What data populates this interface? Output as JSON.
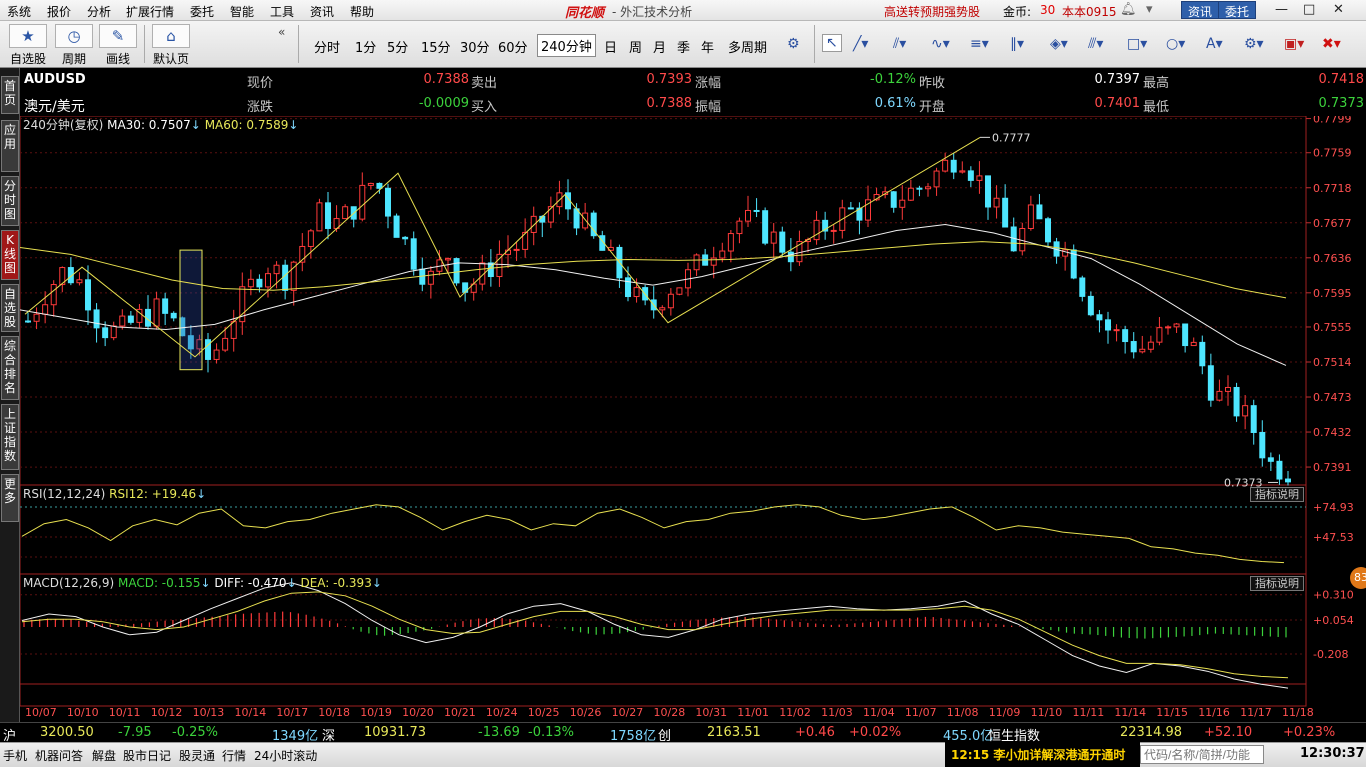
{
  "menu": [
    "系统",
    "报价",
    "分析",
    "扩展行情",
    "委托",
    "智能",
    "工具",
    "资讯",
    "帮助"
  ],
  "brand": {
    "logo": "同花顺",
    "subtitle": "- 外汇技术分析"
  },
  "topright": {
    "promo": "高送转预期强势股",
    "coin_label": "金币:",
    "coin_value": "30",
    "account": "本本0915",
    "btn_info": "资讯",
    "btn_trade": "委托"
  },
  "toolbar": {
    "groups": [
      {
        "label": "自选股",
        "icon": "star-icon"
      },
      {
        "label": "周期",
        "icon": "clock-icon"
      },
      {
        "label": "画线",
        "icon": "pencil-icon"
      },
      {
        "label": "默认页",
        "icon": "home-icon"
      }
    ],
    "collapse": "«",
    "periods": [
      "分时",
      "1分",
      "5分",
      "15分",
      "30分",
      "60分",
      "240分钟",
      "日",
      "周",
      "月",
      "季",
      "年",
      "多周期"
    ],
    "active_period": "240分钟"
  },
  "sidebar_tabs": [
    "首页",
    "应用",
    "分时图",
    "K线图",
    "自选股",
    "综合排名",
    "上证指数",
    "更多"
  ],
  "quote": {
    "code": "AUDUSD",
    "name": "澳元/美元",
    "row1": [
      {
        "label": "现价",
        "value": "0.7388"
      },
      {
        "label": "卖出",
        "value": "0.7393"
      },
      {
        "label": "涨幅",
        "value": "-0.12%"
      },
      {
        "label": "昨收",
        "value": "0.7397"
      },
      {
        "label": "最高",
        "value": "0.7418"
      }
    ],
    "row2": [
      {
        "label": "涨跌",
        "value": "-0.0009"
      },
      {
        "label": "买入",
        "value": "0.7388"
      },
      {
        "label": "振幅",
        "value": "0.61%"
      },
      {
        "label": "开盘",
        "value": "0.7401"
      },
      {
        "label": "最低",
        "value": "0.7373"
      }
    ]
  },
  "main_header": {
    "period": "240分钟(复权)",
    "ma30": "MA30: 0.7507",
    "ma60": "MA60: 0.7589"
  },
  "rsi_header": {
    "name": "RSI(12,12,24)",
    "value": "RSI12: +19.46"
  },
  "macd_header": {
    "name": "MACD(12,26,9)",
    "macd": "MACD: -0.155",
    "diff": "DIFF: -0.470",
    "dea": "DEA: -0.393"
  },
  "indicator_btn": "指标说明",
  "badge": "83",
  "chart_data": {
    "type": "candlestick",
    "symbol": "AUDUSD",
    "price_axis": {
      "ticks": [
        "0.7799",
        "0.7759",
        "0.7718",
        "0.7677",
        "0.7636",
        "0.7595",
        "0.7555",
        "0.7514",
        "0.7473",
        "0.7432",
        "0.7391"
      ],
      "ylim": [
        0.737,
        0.7802
      ]
    },
    "rsi_axis": {
      "ticks": [
        "+74.93",
        "+47.53"
      ]
    },
    "macd_axis": {
      "ticks": [
        "+0.310",
        "+0.054",
        "-0.208"
      ]
    },
    "x_labels": [
      "10/07",
      "10/10",
      "10/11",
      "10/12",
      "10/13",
      "10/14",
      "10/17",
      "10/18",
      "10/19",
      "10/20",
      "10/21",
      "10/24",
      "10/25",
      "10/26",
      "10/27",
      "10/28",
      "10/31",
      "11/01",
      "11/02",
      "11/03",
      "11/04",
      "11/07",
      "11/08",
      "11/09",
      "11/10",
      "11/11",
      "11/14",
      "11/15",
      "11/16",
      "11/17",
      "11/18"
    ],
    "annotations": {
      "high": "0.7777",
      "low": "0.7373"
    },
    "close_path": [
      0.7562,
      0.7598,
      0.7622,
      0.7605,
      0.7555,
      0.7548,
      0.7565,
      0.7575,
      0.756,
      0.753,
      0.7515,
      0.756,
      0.7595,
      0.763,
      0.7612,
      0.765,
      0.7688,
      0.7675,
      0.77,
      0.773,
      0.768,
      0.764,
      0.761,
      0.764,
      0.76,
      0.7618,
      0.7645,
      0.765,
      0.7675,
      0.7705,
      0.7688,
      0.7655,
      0.763,
      0.7595,
      0.757,
      0.76,
      0.761,
      0.7635,
      0.766,
      0.768,
      0.7675,
      0.7655,
      0.764,
      0.766,
      0.768,
      0.769,
      0.7695,
      0.77,
      0.771,
      0.772,
      0.774,
      0.776,
      0.773,
      0.769,
      0.765,
      0.7685,
      0.766,
      0.764,
      0.759,
      0.7555,
      0.754,
      0.753,
      0.7545,
      0.755,
      0.7525,
      0.7475,
      0.7465,
      0.744,
      0.7395,
      0.7388
    ],
    "ma30": [
      0.7575,
      0.7565,
      0.7555,
      0.7552,
      0.7558,
      0.7575,
      0.759,
      0.7605,
      0.762,
      0.763,
      0.7628,
      0.7622,
      0.7612,
      0.7604,
      0.7614,
      0.7628,
      0.7642,
      0.7655,
      0.7668,
      0.7675,
      0.7665,
      0.765,
      0.7635,
      0.7605,
      0.757,
      0.7535,
      0.751
    ],
    "ma60": [
      0.7648,
      0.764,
      0.7625,
      0.761,
      0.76,
      0.7598,
      0.7602,
      0.7608,
      0.7615,
      0.7622,
      0.7628,
      0.7632,
      0.7634,
      0.7633,
      0.7634,
      0.7637,
      0.7642,
      0.7647,
      0.7652,
      0.7655,
      0.7652,
      0.7643,
      0.763,
      0.7615,
      0.76,
      0.7589
    ],
    "rsi": [
      44,
      56,
      60,
      52,
      40,
      54,
      60,
      55,
      66,
      70,
      54,
      52,
      58,
      60,
      66,
      70,
      74,
      72,
      62,
      50,
      58,
      64,
      60,
      50,
      56,
      54,
      66,
      70,
      62,
      52,
      58,
      60,
      66,
      68,
      72,
      74,
      72,
      64,
      60,
      62,
      66,
      70,
      72,
      62,
      50,
      54,
      52,
      48,
      46,
      44,
      42,
      34,
      32,
      28,
      26,
      22,
      20,
      19
    ],
    "macd_hist": [
      0.1,
      0.13,
      0.11,
      0.06,
      0.03,
      0.06,
      0.1,
      0.13,
      0.16,
      0.2,
      0.22,
      0.24,
      0.18,
      0.08,
      -0.06,
      -0.14,
      -0.1,
      -0.04,
      0.06,
      0.13,
      0.14,
      0.1,
      0.03,
      -0.06,
      -0.12,
      -0.1,
      -0.04,
      0.05,
      0.1,
      0.14,
      0.16,
      0.14,
      0.1,
      0.06,
      0.03,
      0.06,
      0.09,
      0.13,
      0.16,
      0.12,
      0.08,
      0.04,
      0.0,
      -0.04,
      -0.1,
      -0.12,
      -0.16,
      -0.18,
      -0.16,
      -0.14,
      -0.1,
      -0.12,
      -0.14,
      -0.16
    ],
    "macd_diff": [
      0.05,
      0.1,
      0.08,
      0.0,
      -0.06,
      -0.04,
      0.05,
      0.14,
      0.22,
      0.3,
      0.34,
      0.28,
      0.18,
      0.05,
      -0.06,
      -0.12,
      -0.08,
      0.0,
      0.1,
      0.16,
      0.18,
      0.12,
      0.02,
      -0.06,
      -0.08,
      -0.02,
      0.06,
      0.1,
      0.12,
      0.14,
      0.16,
      0.14,
      0.13,
      0.14,
      0.16,
      0.2,
      0.1,
      0.02,
      -0.1,
      -0.22,
      -0.3,
      -0.35,
      -0.28,
      -0.3,
      -0.34,
      -0.4,
      -0.44,
      -0.47
    ],
    "macd_dea": [
      0.04,
      0.06,
      0.06,
      0.04,
      0.0,
      -0.02,
      0.0,
      0.06,
      0.12,
      0.2,
      0.26,
      0.27,
      0.24,
      0.16,
      0.06,
      -0.02,
      -0.05,
      -0.04,
      0.02,
      0.08,
      0.12,
      0.12,
      0.08,
      0.02,
      -0.02,
      -0.02,
      0.02,
      0.06,
      0.09,
      0.11,
      0.13,
      0.13,
      0.13,
      0.13,
      0.14,
      0.16,
      0.13,
      0.06,
      -0.04,
      -0.14,
      -0.22,
      -0.28,
      -0.28,
      -0.29,
      -0.32,
      -0.36,
      -0.38,
      -0.39
    ]
  },
  "status": [
    {
      "t": "沪",
      "c": "white"
    },
    {
      "t": "3200.50",
      "c": "yellow"
    },
    {
      "t": "-7.95",
      "c": "green"
    },
    {
      "t": "-0.25%",
      "c": "green"
    },
    {
      "t": "1349亿",
      "c": "cyan"
    },
    {
      "t": "深",
      "c": "white"
    },
    {
      "t": "10931.73",
      "c": "yellow"
    },
    {
      "t": "-13.69",
      "c": "green"
    },
    {
      "t": "-0.13%",
      "c": "green"
    },
    {
      "t": "1758亿",
      "c": "cyan"
    },
    {
      "t": "创",
      "c": "white"
    },
    {
      "t": "2163.51",
      "c": "yellow"
    },
    {
      "t": "+0.46",
      "c": "red"
    },
    {
      "t": "+0.02%",
      "c": "red"
    },
    {
      "t": "455.0亿",
      "c": "cyan"
    },
    {
      "t": "恒生指数",
      "c": "white"
    },
    {
      "t": "22314.98",
      "c": "yellow"
    },
    {
      "t": "+52.10",
      "c": "red"
    },
    {
      "t": "+0.23%",
      "c": "red"
    }
  ],
  "taskbar": [
    "手机",
    "机器问答",
    "解盘",
    "股市日记",
    "股灵通",
    "行情",
    "24小时滚动"
  ],
  "news": "12:15 李小加详解深港通开通时",
  "search_placeholder": "代码/名称/简拼/功能",
  "clock": "12:30:37"
}
